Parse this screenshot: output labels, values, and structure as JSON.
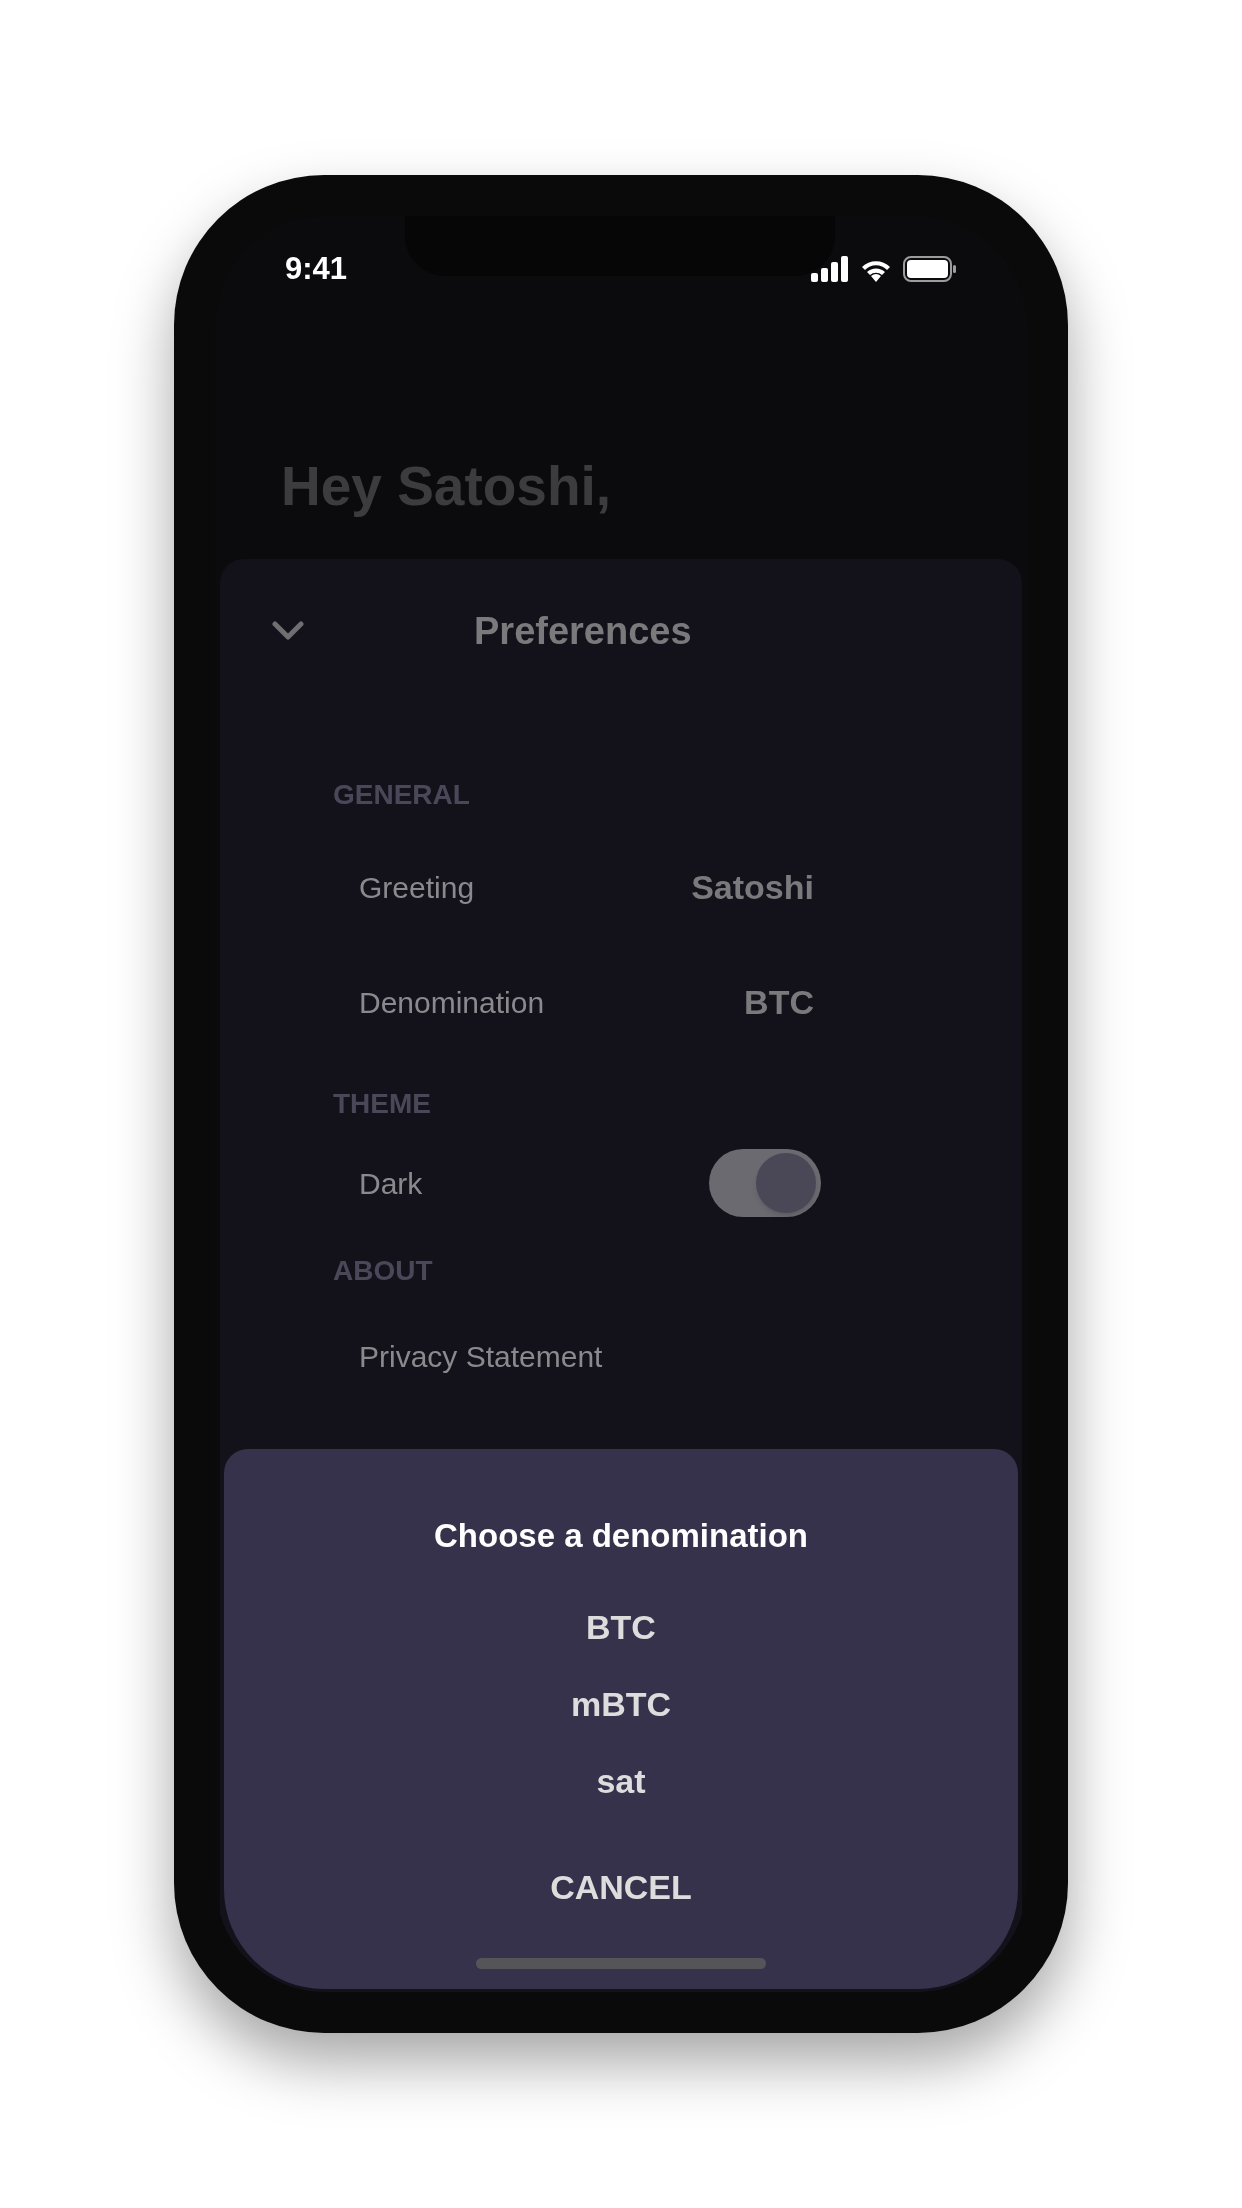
{
  "status_bar": {
    "time": "9:41"
  },
  "greeting": {
    "line_1": "Hey Satoshi,"
  },
  "preferences": {
    "title": "Preferences",
    "sections": [
      {
        "heading": "GENERAL",
        "rows": [
          {
            "kind": "value",
            "label": "Greeting",
            "value": "Satoshi"
          },
          {
            "kind": "value",
            "label": "Denomination",
            "value": "BTC"
          }
        ]
      },
      {
        "heading": "THEME",
        "rows": [
          {
            "kind": "toggle",
            "label": "Dark",
            "on": true
          }
        ]
      },
      {
        "heading": "ABOUT",
        "rows": [
          {
            "kind": "link",
            "label": "Privacy Statement"
          }
        ]
      }
    ]
  },
  "dialog": {
    "title": "Choose a denomination",
    "options": [
      "BTC",
      "mBTC",
      "sat"
    ],
    "cancel": "CANCEL"
  }
}
